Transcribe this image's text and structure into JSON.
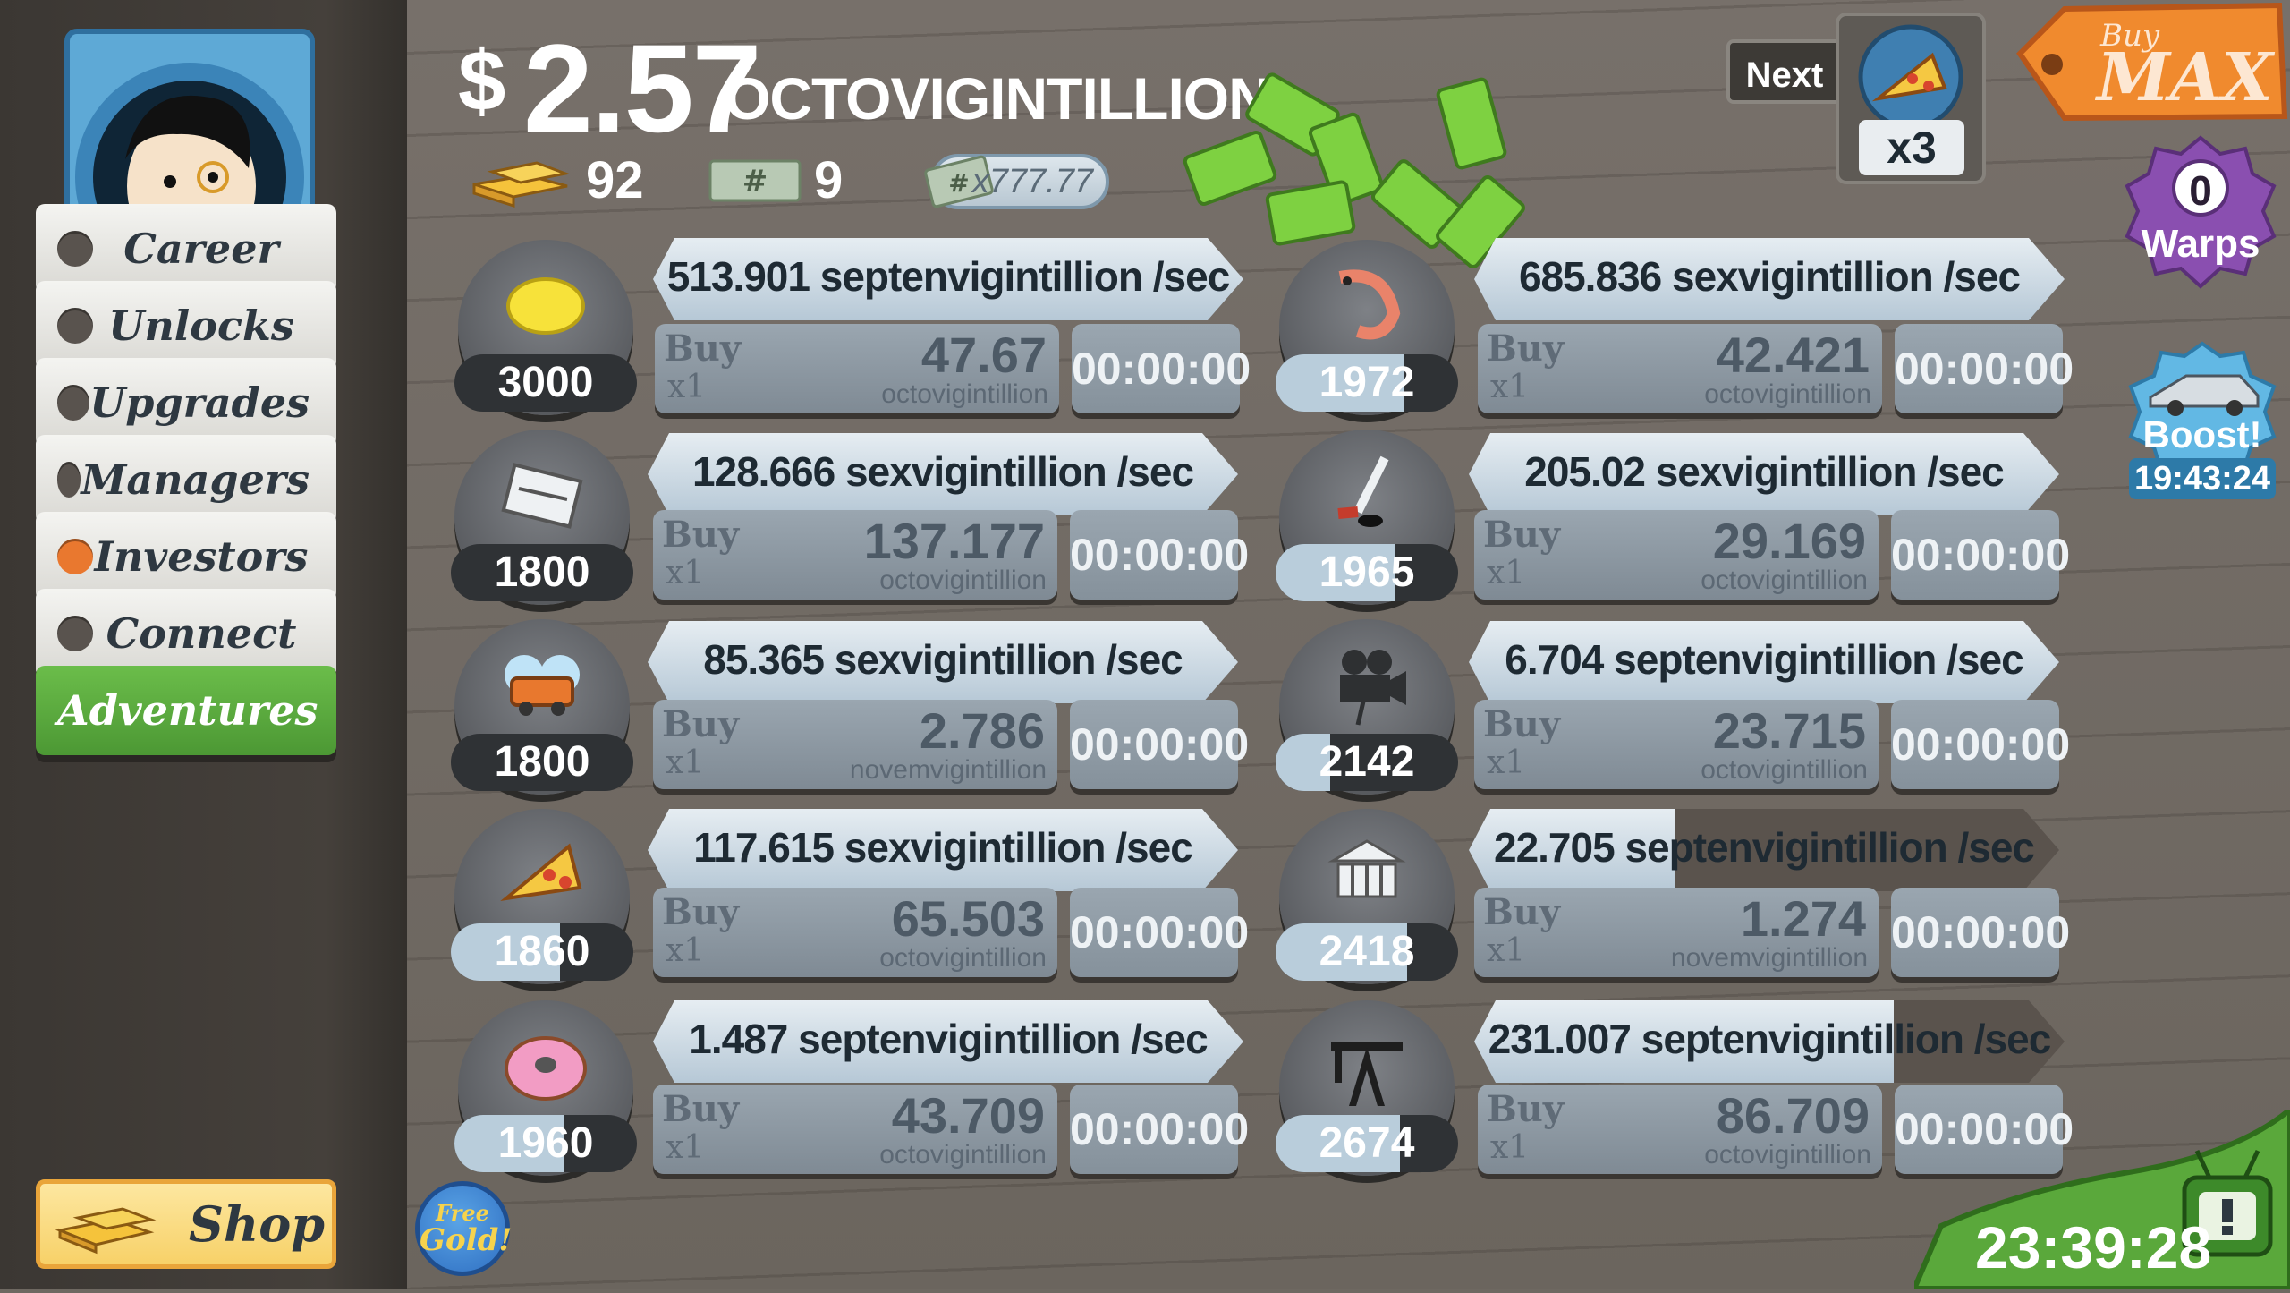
{
  "header": {
    "money_symbol": "$",
    "money_value": "2.57",
    "money_unit": "OCTOVIGINTILLION",
    "gold_count": "92",
    "megabucks_count": "9",
    "multiplier_label": "x777.77"
  },
  "sidebar": {
    "items": [
      {
        "label": "Career",
        "active": false,
        "alert": false
      },
      {
        "label": "Unlocks",
        "active": false,
        "alert": false
      },
      {
        "label": "Upgrades",
        "active": false,
        "alert": false
      },
      {
        "label": "Managers",
        "active": false,
        "alert": false
      },
      {
        "label": "Investors",
        "active": false,
        "alert": true
      },
      {
        "label": "Connect",
        "active": false,
        "alert": false
      },
      {
        "label": "Adventures",
        "active": true,
        "alert": false
      }
    ],
    "shop_label": "Shop"
  },
  "businesses": [
    {
      "icon": "lemon-icon",
      "level": "3000",
      "level_progress": 0,
      "rate": "513.901 septenvigintillion /sec",
      "rate_progress": 1.0,
      "buy_label": "Buy",
      "buy_qty": "x1",
      "price": "47.67",
      "price_unit": "octovigintillion",
      "timer": "00:00:00"
    },
    {
      "icon": "newspaper-icon",
      "level": "1800",
      "level_progress": 0,
      "rate": "128.666 sexvigintillion /sec",
      "rate_progress": 1.0,
      "buy_label": "Buy",
      "buy_qty": "x1",
      "price": "137.177",
      "price_unit": "octovigintillion",
      "timer": "00:00:00"
    },
    {
      "icon": "car-wash-icon",
      "level": "1800",
      "level_progress": 0,
      "rate": "85.365 sexvigintillion /sec",
      "rate_progress": 1.0,
      "buy_label": "Buy",
      "buy_qty": "x1",
      "price": "2.786",
      "price_unit": "novemvigintillion",
      "timer": "00:00:00"
    },
    {
      "icon": "pizza-icon",
      "level": "1860",
      "level_progress": 0.6,
      "rate": "117.615 sexvigintillion /sec",
      "rate_progress": 1.0,
      "buy_label": "Buy",
      "buy_qty": "x1",
      "price": "65.503",
      "price_unit": "octovigintillion",
      "timer": "00:00:00"
    },
    {
      "icon": "donut-icon",
      "level": "1960",
      "level_progress": 0.6,
      "rate": "1.487 septenvigintillion /sec",
      "rate_progress": 1.0,
      "buy_label": "Buy",
      "buy_qty": "x1",
      "price": "43.709",
      "price_unit": "octovigintillion",
      "timer": "00:00:00"
    },
    {
      "icon": "shrimp-icon",
      "level": "1972",
      "level_progress": 0.7,
      "rate": "685.836 sexvigintillion /sec",
      "rate_progress": 1.0,
      "buy_label": "Buy",
      "buy_qty": "x1",
      "price": "42.421",
      "price_unit": "octovigintillion",
      "timer": "00:00:00"
    },
    {
      "icon": "hockey-icon",
      "level": "1965",
      "level_progress": 0.65,
      "rate": "205.02 sexvigintillion /sec",
      "rate_progress": 1.0,
      "buy_label": "Buy",
      "buy_qty": "x1",
      "price": "29.169",
      "price_unit": "octovigintillion",
      "timer": "00:00:00"
    },
    {
      "icon": "movie-camera-icon",
      "level": "2142",
      "level_progress": 0.3,
      "rate": "6.704 septenvigintillion /sec",
      "rate_progress": 1.0,
      "buy_label": "Buy",
      "buy_qty": "x1",
      "price": "23.715",
      "price_unit": "octovigintillion",
      "timer": "00:00:00"
    },
    {
      "icon": "bank-icon",
      "level": "2418",
      "level_progress": 0.72,
      "rate": "22.705 septenvigintillion /sec",
      "rate_progress": 0.35,
      "buy_label": "Buy",
      "buy_qty": "x1",
      "price": "1.274",
      "price_unit": "novemvigintillion",
      "timer": "00:00:00"
    },
    {
      "icon": "oil-rig-icon",
      "level": "2674",
      "level_progress": 0.68,
      "rate": "231.007 septenvigintillion /sec",
      "rate_progress": 0.71,
      "buy_label": "Buy",
      "buy_qty": "x1",
      "price": "86.709",
      "price_unit": "octovigintillion",
      "timer": "00:00:00"
    }
  ],
  "next_unlock": {
    "label": "Next",
    "multiplier": "x3",
    "icon": "pizza-icon"
  },
  "buy_max": {
    "line1": "Buy",
    "line2": "MAX"
  },
  "warps": {
    "count": "0",
    "label": "Warps"
  },
  "boost": {
    "label": "Boost!",
    "timer": "19:43:24"
  },
  "free_gold": {
    "line1": "Free",
    "line2": "Gold!"
  },
  "event_timer": "23:39:28",
  "colors": {
    "accent_green": "#5aa83b",
    "investor_orange": "#e9782f",
    "rate_bar": "#c9d8e3"
  }
}
